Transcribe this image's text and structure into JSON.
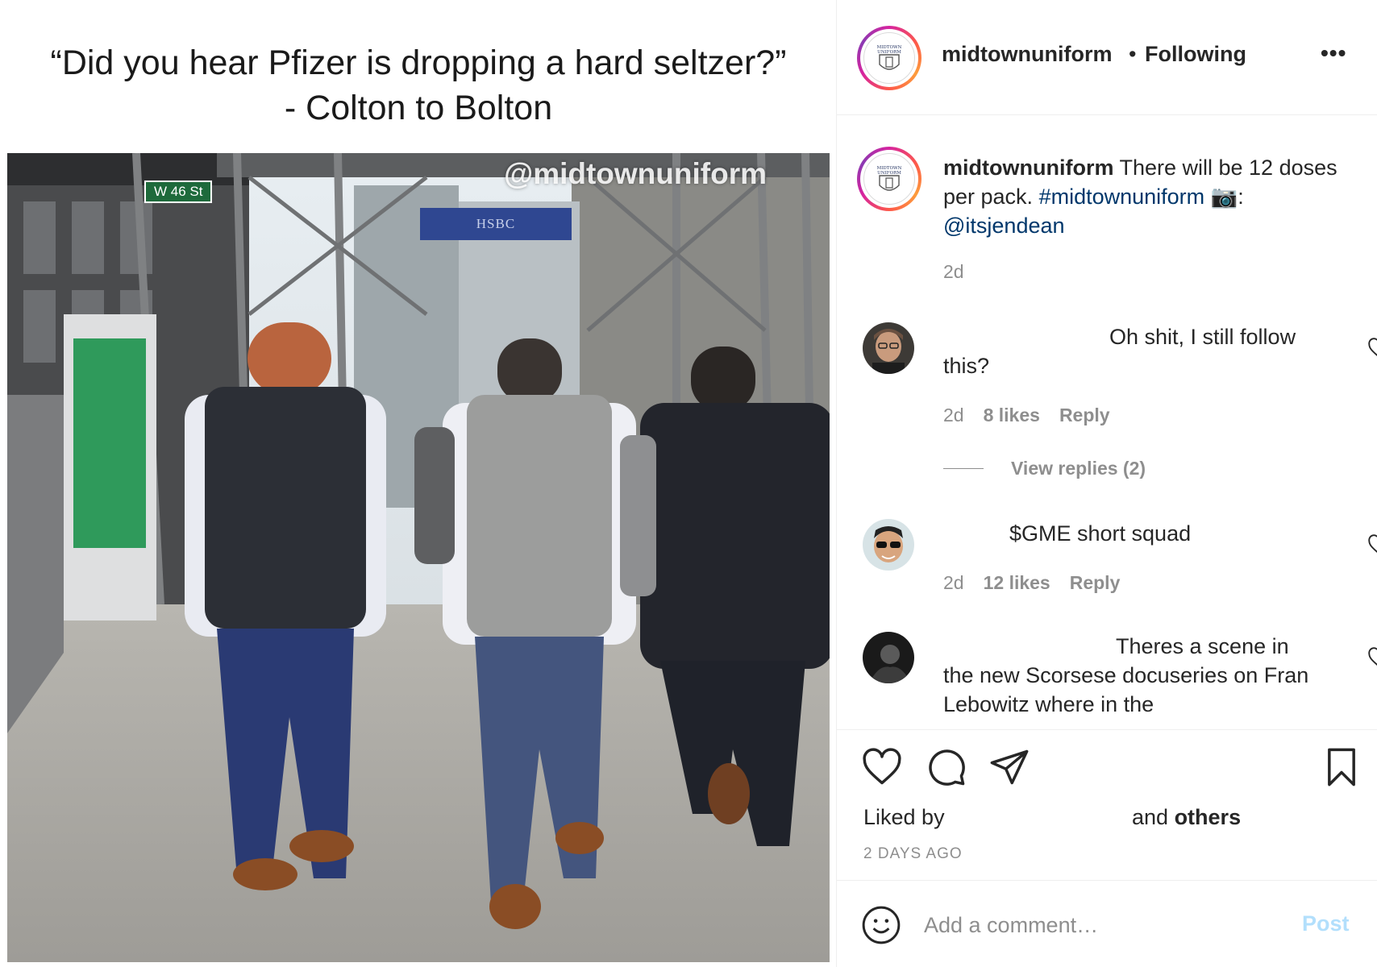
{
  "media": {
    "caption_line1": "“Did you hear Pfizer is dropping a hard seltzer?”",
    "caption_line2": "- Colton to Bolton",
    "watermark": "@midtownuniform",
    "street_sign": "W 46 St",
    "bank_sign": "HSBC"
  },
  "header": {
    "username": "midtownuniform",
    "separator": "•",
    "follow_status": "Following",
    "more_label": "•••",
    "logo_text": "MIDTOWN UNIFORM"
  },
  "post_caption": {
    "username": "midtownuniform",
    "text": " There will be 12 doses per pack. ",
    "hashtag": "#midtownuniform",
    "camera": " 📷: ",
    "mention": "@itsjendean",
    "time": "2d"
  },
  "comments": [
    {
      "text": "Oh shit, I still follow this?",
      "time": "2d",
      "likes": "8 likes",
      "reply": "Reply",
      "view_replies": "View replies (2)"
    },
    {
      "text": "$GME short squad",
      "time": "2d",
      "likes": "12 likes",
      "reply": "Reply"
    },
    {
      "text": "Theres a scene in the new Scorsese docuseries on Fran Lebowitz where in the"
    }
  ],
  "actions": {
    "liked_by": "Liked by",
    "and": "and ",
    "others": "others",
    "date": "2 DAYS AGO"
  },
  "add_comment": {
    "placeholder": "Add a comment…",
    "post_label": "Post"
  },
  "colors": {
    "link": "#00376b",
    "muted": "#8e8e8e",
    "post_disabled": "#b2dffc",
    "border": "#efefef"
  }
}
